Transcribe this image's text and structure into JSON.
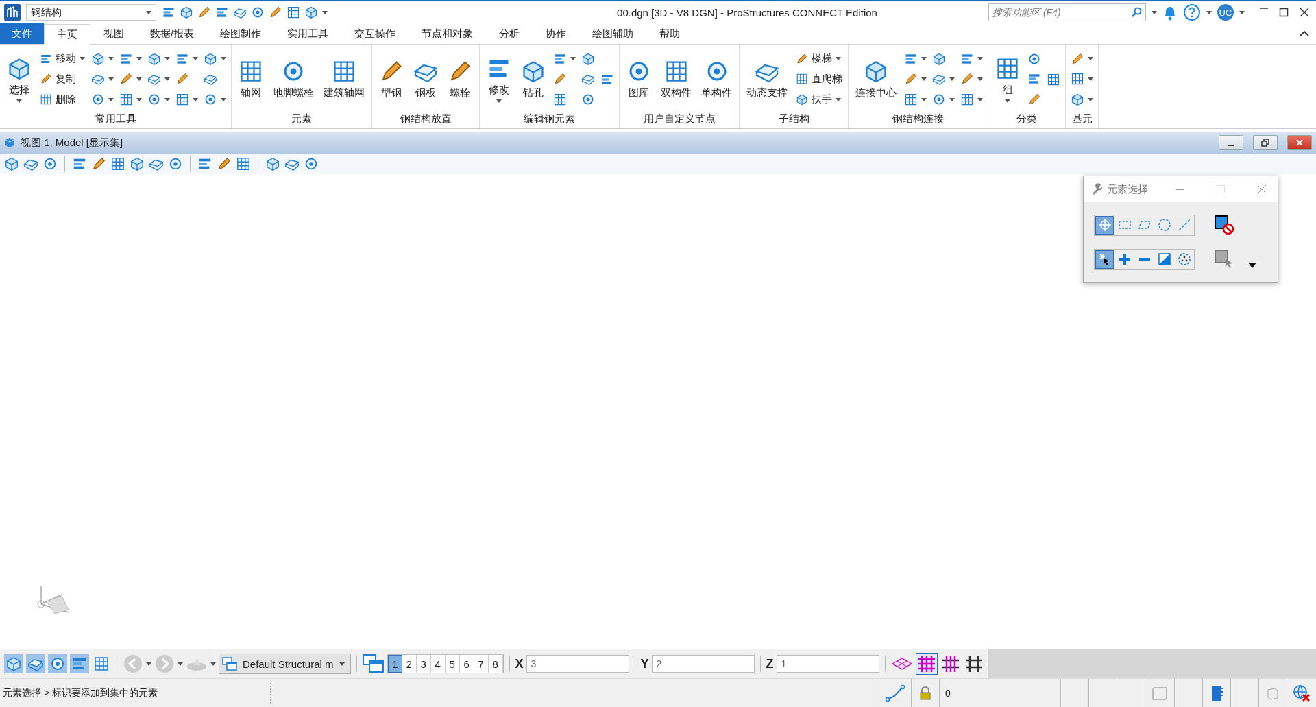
{
  "title_bar": {
    "workspace": "钢结构",
    "title": "00.dgn [3D - V8 DGN] - ProStructures CONNECT Edition",
    "search": {
      "placeholder": "搜索功能区 (F4)"
    },
    "user": "UC"
  },
  "tabs": [
    {
      "label": "文件",
      "kind": "file",
      "selected": false
    },
    {
      "label": "主页",
      "kind": "tab",
      "selected": true
    },
    {
      "label": "视图",
      "kind": "tab",
      "selected": false
    },
    {
      "label": "数据/报表",
      "kind": "tab",
      "selected": false
    },
    {
      "label": "绘图制作",
      "kind": "tab",
      "selected": false
    },
    {
      "label": "实用工具",
      "kind": "tab",
      "selected": false
    },
    {
      "label": "交互操作",
      "kind": "tab",
      "selected": false
    },
    {
      "label": "节点和对象",
      "kind": "tab",
      "selected": false
    },
    {
      "label": "分析",
      "kind": "tab",
      "selected": false
    },
    {
      "label": "协作",
      "kind": "tab",
      "selected": false
    },
    {
      "label": "绘图辅助",
      "kind": "tab",
      "selected": false
    },
    {
      "label": "帮助",
      "kind": "tab",
      "selected": false
    }
  ],
  "ribbon_groups": [
    {
      "label": "常用工具",
      "columns": [
        [
          {
            "kind": "large",
            "label": "选择",
            "menu": true
          }
        ],
        [
          {
            "kind": "small",
            "label": "移动",
            "menu": true
          },
          {
            "kind": "small",
            "label": "复制",
            "menu": false
          },
          {
            "kind": "small",
            "label": "删除",
            "menu": false
          }
        ],
        [
          {
            "kind": "icon",
            "menu": true
          },
          {
            "kind": "icon",
            "menu": true
          },
          {
            "kind": "icon",
            "menu": true
          }
        ],
        [
          {
            "kind": "icon",
            "menu": true
          },
          {
            "kind": "icon",
            "menu": true
          },
          {
            "kind": "icon",
            "menu": true
          }
        ],
        [
          {
            "kind": "icon",
            "menu": true
          },
          {
            "kind": "icon",
            "menu": true
          },
          {
            "kind": "icon",
            "menu": true
          }
        ],
        [
          {
            "kind": "icon",
            "menu": true
          },
          {
            "kind": "icon",
            "menu": false
          },
          {
            "kind": "icon",
            "menu": true
          }
        ],
        [
          {
            "kind": "icon",
            "menu": true
          },
          {
            "kind": "icon",
            "menu": false
          },
          {
            "kind": "icon",
            "menu": true
          }
        ]
      ]
    },
    {
      "label": "元素",
      "columns": [
        [
          {
            "kind": "large",
            "label": "轴网",
            "menu": false
          }
        ],
        [
          {
            "kind": "large",
            "label": "地脚螺栓",
            "menu": false
          }
        ],
        [
          {
            "kind": "large",
            "label": "建筑轴网",
            "menu": false
          }
        ]
      ]
    },
    {
      "label": "钢结构放置",
      "columns": [
        [
          {
            "kind": "large",
            "label": "型钢",
            "menu": false
          }
        ],
        [
          {
            "kind": "large",
            "label": "钢板",
            "menu": false
          }
        ],
        [
          {
            "kind": "large",
            "label": "螺栓",
            "menu": false
          }
        ]
      ]
    },
    {
      "label": "编辑钢元素",
      "columns": [
        [
          {
            "kind": "large",
            "label": "修改",
            "menu": true
          }
        ],
        [
          {
            "kind": "large",
            "label": "钻孔",
            "menu": false
          }
        ],
        [
          {
            "kind": "icon",
            "menu": true
          },
          {
            "kind": "icon",
            "menu": false
          },
          {
            "kind": "icon",
            "menu": false
          }
        ],
        [
          {
            "kind": "icon",
            "menu": false
          },
          {
            "kind": "icon",
            "menu": false
          },
          {
            "kind": "icon",
            "menu": false
          }
        ],
        [
          {
            "kind": "icon",
            "menu": false
          }
        ]
      ]
    },
    {
      "label": "用户自定义节点",
      "columns": [
        [
          {
            "kind": "large",
            "label": "图库",
            "menu": false
          }
        ],
        [
          {
            "kind": "large",
            "label": "双构件",
            "menu": false
          }
        ],
        [
          {
            "kind": "large",
            "label": "单构件",
            "menu": false
          }
        ]
      ]
    },
    {
      "label": "子结构",
      "columns": [
        [
          {
            "kind": "large",
            "label": "动态支撑",
            "menu": false
          }
        ],
        [
          {
            "kind": "small",
            "label": "楼梯",
            "menu": true
          },
          {
            "kind": "small",
            "label": "直爬梯",
            "menu": false
          },
          {
            "kind": "small",
            "label": "扶手",
            "menu": true
          }
        ]
      ]
    },
    {
      "label": "钢结构连接",
      "columns": [
        [
          {
            "kind": "large",
            "label": "连接中心",
            "menu": false
          }
        ],
        [
          {
            "kind": "icon",
            "menu": true
          },
          {
            "kind": "icon",
            "menu": true
          },
          {
            "kind": "icon",
            "menu": true
          }
        ],
        [
          {
            "kind": "icon",
            "menu": false
          },
          {
            "kind": "icon",
            "menu": true
          },
          {
            "kind": "icon",
            "menu": true
          }
        ],
        [
          {
            "kind": "icon",
            "menu": true
          },
          {
            "kind": "icon",
            "menu": true
          },
          {
            "kind": "icon",
            "menu": true
          }
        ]
      ]
    },
    {
      "label": "分类",
      "columns": [
        [
          {
            "kind": "large",
            "label": "组",
            "menu": true
          }
        ],
        [
          {
            "kind": "icon",
            "menu": false
          },
          {
            "kind": "icon",
            "menu": false
          },
          {
            "kind": "icon",
            "menu": false
          }
        ],
        [
          {
            "kind": "icon",
            "menu": false
          }
        ]
      ]
    },
    {
      "label": "基元",
      "columns": [
        [
          {
            "kind": "icon",
            "menu": true
          },
          {
            "kind": "icon",
            "menu": true
          },
          {
            "kind": "icon",
            "menu": true
          }
        ]
      ]
    }
  ],
  "view_window": {
    "title": "视图 1, Model [显示集]"
  },
  "selection_dialog": {
    "title": "元素选择",
    "methods": [
      {
        "kind": "individual",
        "selected": true
      },
      {
        "kind": "block",
        "selected": false
      },
      {
        "kind": "shape",
        "selected": false
      },
      {
        "kind": "circle",
        "selected": false
      },
      {
        "kind": "line",
        "selected": false
      }
    ],
    "modes": [
      {
        "kind": "new",
        "selected": true
      },
      {
        "kind": "add",
        "selected": false
      },
      {
        "kind": "subtract",
        "selected": false
      },
      {
        "kind": "invert",
        "selected": false
      },
      {
        "kind": "all",
        "selected": false
      }
    ]
  },
  "bottom_toolbar": {
    "model": "Default Structural m",
    "views": [
      {
        "label": "1",
        "selected": true
      },
      {
        "label": "2",
        "selected": false
      },
      {
        "label": "3",
        "selected": false
      },
      {
        "label": "4",
        "selected": false
      },
      {
        "label": "5",
        "selected": false
      },
      {
        "label": "6",
        "selected": false
      },
      {
        "label": "7",
        "selected": false
      },
      {
        "label": "8",
        "selected": false
      }
    ],
    "coords": [
      {
        "axis": "X",
        "value": "3"
      },
      {
        "axis": "Y",
        "value": "2"
      },
      {
        "axis": "Z",
        "value": "1"
      }
    ]
  },
  "status_bar": {
    "prompt": "元素选择 > 标识要添加到集中的元素",
    "lock_value": "0"
  }
}
